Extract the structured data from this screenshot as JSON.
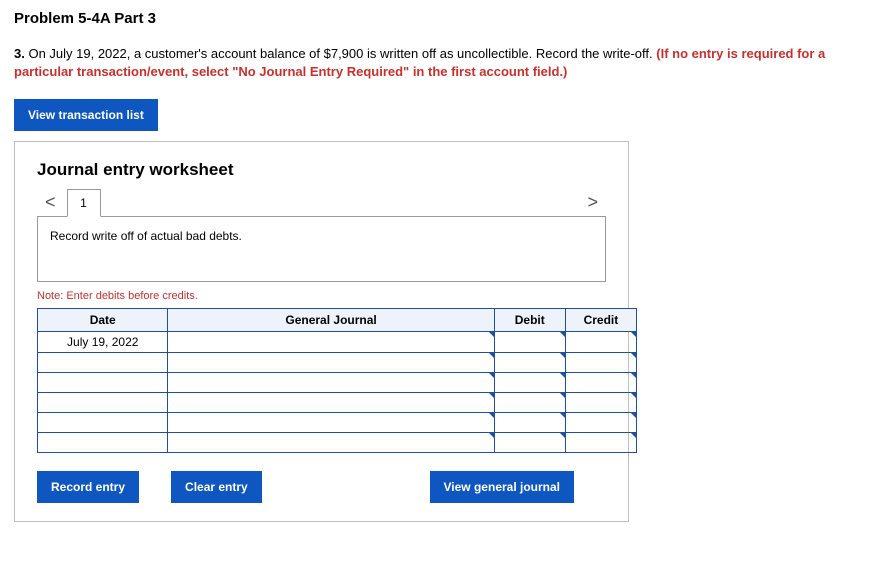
{
  "header": {
    "problem_title": "Problem 5-4A Part 3"
  },
  "question": {
    "number": "3.",
    "text": " On July 19, 2022, a customer's account balance of $7,900 is written off as uncollectible. Record the write-off. ",
    "red_text": "(If no entry is required for a particular transaction/event, select \"No Journal Entry Required\" in the first account field.)"
  },
  "buttons": {
    "view_transaction_list": "View transaction list",
    "record_entry": "Record entry",
    "clear_entry": "Clear entry",
    "view_general_journal": "View general journal"
  },
  "worksheet": {
    "title": "Journal entry worksheet",
    "prev": "<",
    "next": ">",
    "tab_label": "1",
    "instruction": "Record write off of actual bad debts.",
    "note": "Note: Enter debits before credits.",
    "columns": {
      "date": "Date",
      "general_journal": "General Journal",
      "debit": "Debit",
      "credit": "Credit"
    },
    "rows": [
      {
        "date": "July 19, 2022",
        "journal": "",
        "debit": "",
        "credit": ""
      },
      {
        "date": "",
        "journal": "",
        "debit": "",
        "credit": ""
      },
      {
        "date": "",
        "journal": "",
        "debit": "",
        "credit": ""
      },
      {
        "date": "",
        "journal": "",
        "debit": "",
        "credit": ""
      },
      {
        "date": "",
        "journal": "",
        "debit": "",
        "credit": ""
      },
      {
        "date": "",
        "journal": "",
        "debit": "",
        "credit": ""
      }
    ]
  }
}
